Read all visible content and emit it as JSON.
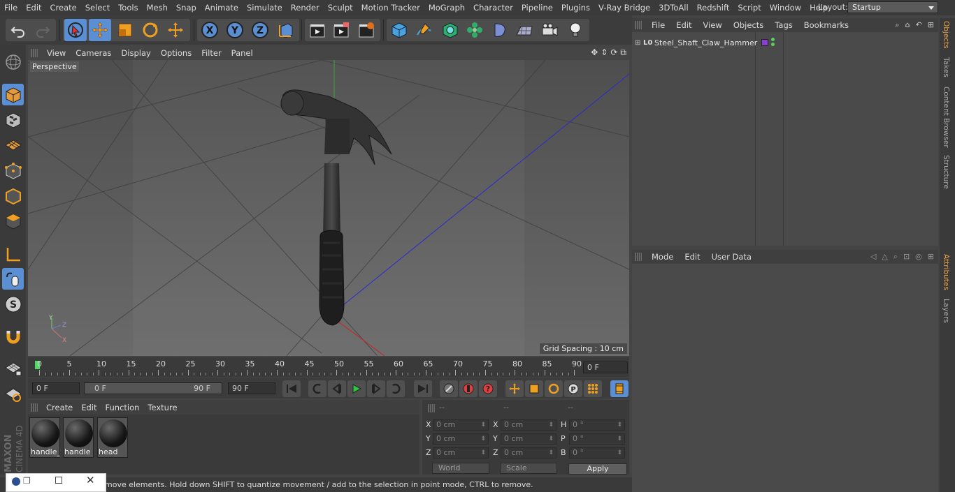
{
  "menu": [
    "File",
    "Edit",
    "Create",
    "Select",
    "Tools",
    "Mesh",
    "Snap",
    "Animate",
    "Simulate",
    "Render",
    "Sculpt",
    "Motion Tracker",
    "MoGraph",
    "Character",
    "Pipeline",
    "Plugins",
    "V-Ray Bridge",
    "3DToAll",
    "Redshift",
    "Script",
    "Window",
    "Help"
  ],
  "layout": {
    "label": "Layout:",
    "value": "Startup"
  },
  "viewport": {
    "menu": [
      "View",
      "Cameras",
      "Display",
      "Options",
      "Filter",
      "Panel"
    ],
    "label": "Perspective",
    "grid_spacing": "Grid Spacing : 10 cm",
    "axis_labels": {
      "y": "Y",
      "z": "Z",
      "x": "X"
    }
  },
  "timeline": {
    "ticks": [
      "0",
      "5",
      "10",
      "15",
      "20",
      "25",
      "30",
      "35",
      "40",
      "45",
      "50",
      "55",
      "60",
      "65",
      "70",
      "75",
      "80",
      "85",
      "90"
    ],
    "current_frame": "0 F"
  },
  "transport": {
    "start_field": "0 F",
    "range_start": "0 F",
    "range_end": "90 F",
    "end_field": "90 F"
  },
  "materials": {
    "menu": [
      "Create",
      "Edit",
      "Function",
      "Texture"
    ],
    "items": [
      "handle_",
      "handle",
      "head"
    ]
  },
  "coords": {
    "headers": [
      "--",
      "--",
      "--"
    ],
    "pos_labels": [
      "X",
      "Y",
      "Z"
    ],
    "pos_values": [
      "0 cm",
      "0 cm",
      "0 cm"
    ],
    "size_labels": [
      "X",
      "Y",
      "Z"
    ],
    "size_values": [
      "0 cm",
      "0 cm",
      "0 cm"
    ],
    "rot_labels": [
      "H",
      "P",
      "B"
    ],
    "rot_values": [
      "0 °",
      "0 °",
      "0 °"
    ],
    "mode": "World",
    "scale": "Scale",
    "apply": "Apply"
  },
  "status": "move elements. Hold down SHIFT to quantize movement / add to the selection in point mode, CTRL to remove.",
  "object_manager": {
    "menu": [
      "File",
      "Edit",
      "View",
      "Objects",
      "Tags",
      "Bookmarks"
    ],
    "object_name": "Steel_Shaft_Claw_Hammer"
  },
  "attributes": {
    "menu": [
      "Mode",
      "Edit",
      "User Data"
    ]
  },
  "side_tabs": [
    "Objects",
    "Takes",
    "Content Browser",
    "Structure",
    "Attributes",
    "Layers"
  ],
  "logo": {
    "brand": "MAXON",
    "product": "CINEMA 4D"
  },
  "colors": {
    "accent": "#e8a14a",
    "selection_blue": "#5b8fd4",
    "object_tag": "#8a3fd1"
  }
}
